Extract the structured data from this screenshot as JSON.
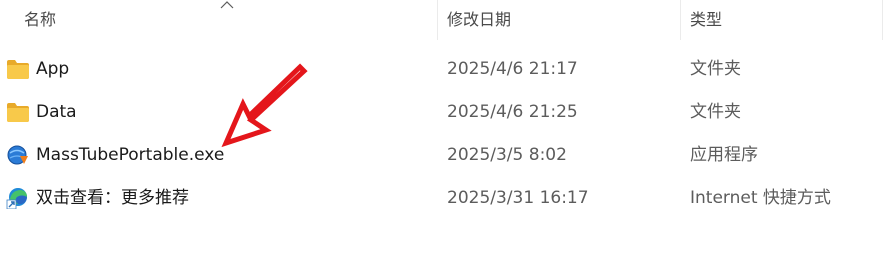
{
  "header": {
    "name_label": "名称",
    "date_label": "修改日期",
    "type_label": "类型",
    "sort_indicator": "chevron-up-icon"
  },
  "files": [
    {
      "name": "App",
      "date": "2025/4/6 21:17",
      "type": "文件夹",
      "icon": "folder-icon"
    },
    {
      "name": "Data",
      "date": "2025/4/6 21:25",
      "type": "文件夹",
      "icon": "folder-icon"
    },
    {
      "name": "MassTubePortable.exe",
      "date": "2025/3/5 8:02",
      "type": "应用程序",
      "icon": "app-exe-icon"
    },
    {
      "name": "双击查看：更多推荐",
      "date": "2025/3/31 16:17",
      "type": "Internet 快捷方式",
      "icon": "internet-shortcut-icon"
    }
  ],
  "annotation": {
    "arrow_color": "#e4161b",
    "points_to": "MassTubePortable.exe"
  },
  "colors": {
    "folder": "#f8c94a",
    "text": "#1a1a1a",
    "secondary_text": "#5c5c5c"
  }
}
